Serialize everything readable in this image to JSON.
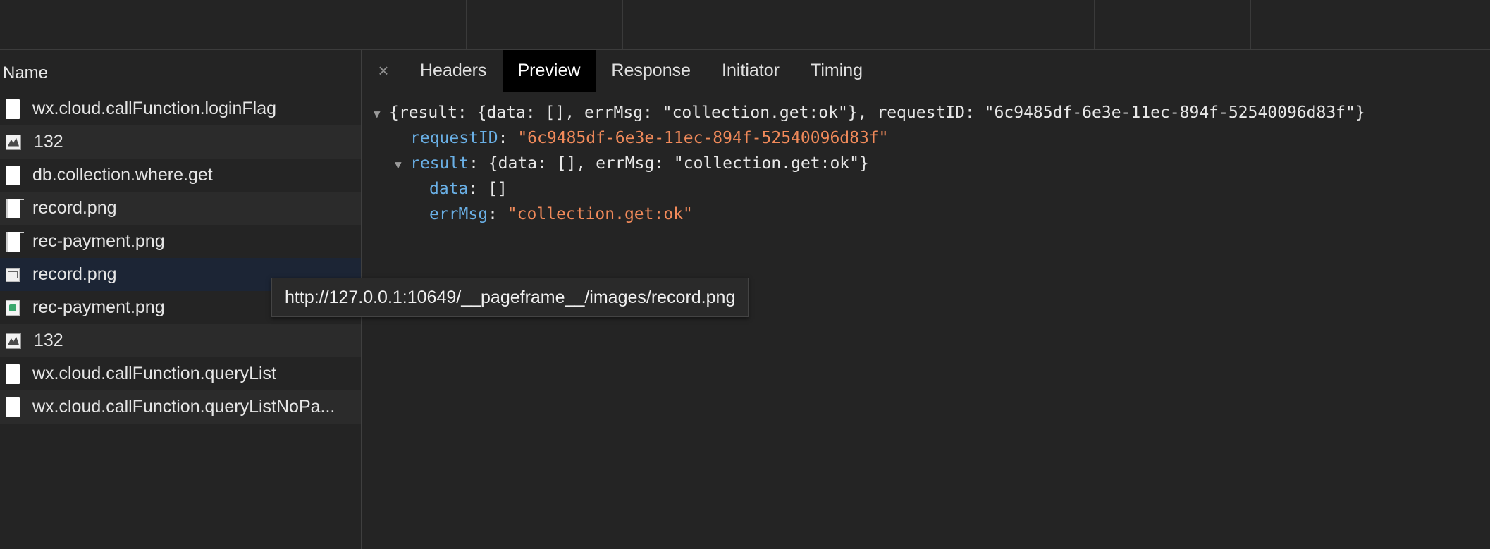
{
  "network": {
    "name_header": "Name",
    "requests": [
      {
        "label": "wx.cloud.callFunction.loginFlag",
        "icon": "document-icon"
      },
      {
        "label": "132",
        "icon": "image-thumbnail-icon"
      },
      {
        "label": "db.collection.where.get",
        "icon": "document-icon"
      },
      {
        "label": "record.png",
        "icon": "image-file-icon"
      },
      {
        "label": "rec-payment.png",
        "icon": "image-file-icon"
      },
      {
        "label": "record.png",
        "icon": "image-thumbnail-icon"
      },
      {
        "label": "rec-payment.png",
        "icon": "image-thumbnail-icon"
      },
      {
        "label": "132",
        "icon": "image-thumbnail-icon"
      },
      {
        "label": "wx.cloud.callFunction.queryList",
        "icon": "document-icon"
      },
      {
        "label": "wx.cloud.callFunction.queryListNoPa...",
        "icon": "document-icon"
      }
    ]
  },
  "details": {
    "close_glyph": "×",
    "tabs": [
      "Headers",
      "Preview",
      "Response",
      "Initiator",
      "Timing"
    ],
    "active_tab": "Preview"
  },
  "preview": {
    "summary": "{result: {data: [], errMsg: \"collection.get:ok\"}, requestID: \"6c9485df-6e3e-11ec-894f-52540096d83f\"}",
    "requestID_key": "requestID",
    "requestID_value": "\"6c9485df-6e3e-11ec-894f-52540096d83f\"",
    "result_key": "result",
    "result_summary": "{data: [], errMsg: \"collection.get:ok\"}",
    "data_key": "data",
    "data_value": "[]",
    "errMsg_key": "errMsg",
    "errMsg_value": "\"collection.get:ok\""
  },
  "tooltip": {
    "text": "http://127.0.0.1:10649/__pageframe__/images/record.png"
  },
  "colors": {
    "background": "#242424",
    "selected_row": "#1c2535",
    "active_tab": "#000000",
    "json_key": "#6ab0e6",
    "json_string": "#f18a5a"
  }
}
